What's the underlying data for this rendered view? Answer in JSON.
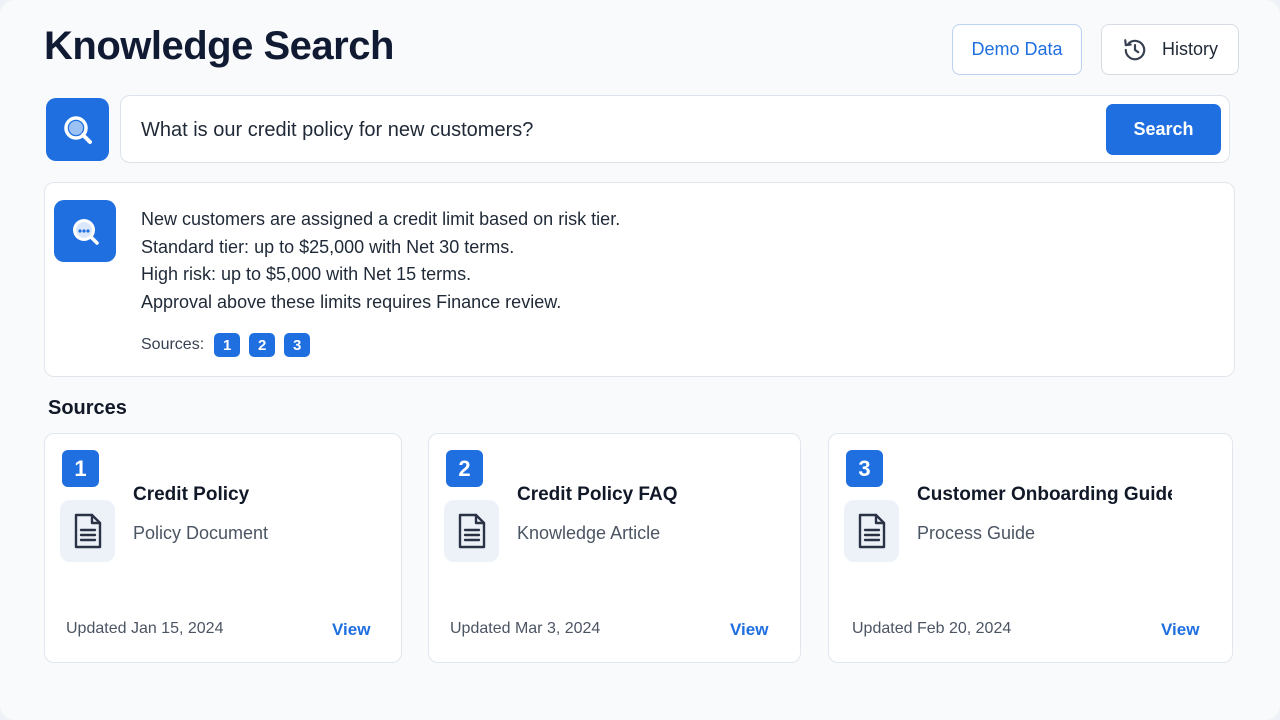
{
  "header": {
    "title": "Knowledge Search",
    "demo_label": "Demo Data",
    "history_label": "History"
  },
  "search": {
    "query": "What is our credit policy for new customers?",
    "button_label": "Search"
  },
  "answer": {
    "lines": [
      "New customers are assigned a credit limit based on risk tier.",
      "Standard tier: up to $25,000 with Net 30 terms.",
      "High risk: up to $5,000 with Net 15 terms.",
      "Approval above these limits requires Finance review."
    ],
    "sources_label": "Sources:",
    "source_refs": [
      "1",
      "2",
      "3"
    ]
  },
  "sources": {
    "heading": "Sources",
    "cards": [
      {
        "number": "1",
        "title": "Credit Policy",
        "type": "Policy Document",
        "updated": "Updated Jan 15, 2024",
        "view_label": "View"
      },
      {
        "number": "2",
        "title": "Credit Policy FAQ",
        "type": "Knowledge Article",
        "updated": "Updated Mar 3, 2024",
        "view_label": "View"
      },
      {
        "number": "3",
        "title": "Customer Onboarding Guide",
        "type": "Process Guide",
        "updated": "Updated Feb 20, 2024",
        "view_label": "View"
      }
    ]
  },
  "icons": {
    "history": "history-clock-icon",
    "search_logo": "magnifier-icon",
    "answer": "ai-chat-magnifier-icon",
    "document": "document-icon"
  },
  "colors": {
    "accent": "#1f6fe0",
    "title": "#111a33",
    "background": "#f9fafc"
  }
}
